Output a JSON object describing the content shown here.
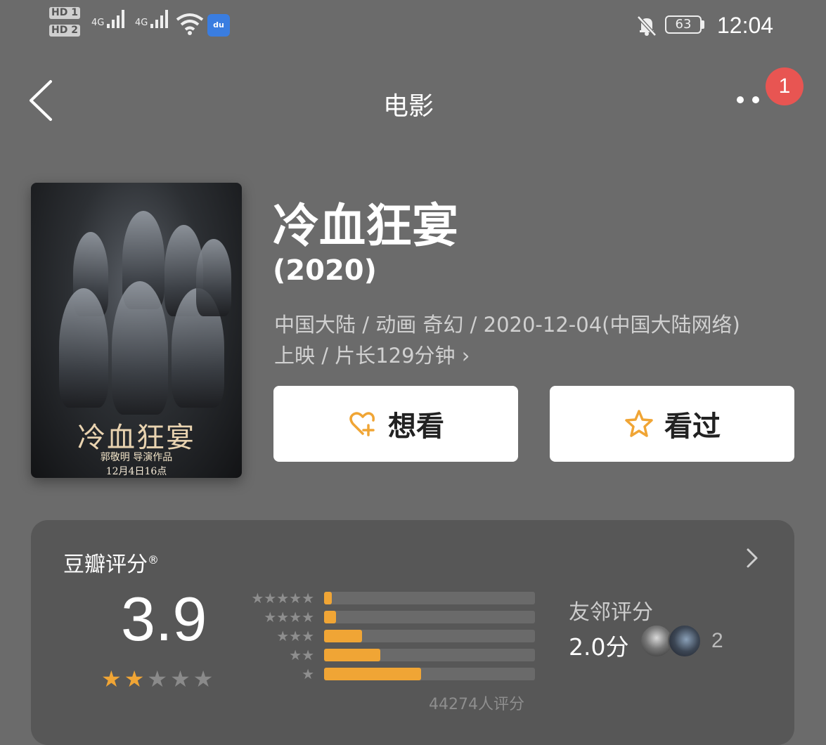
{
  "status_bar": {
    "hd1": "HD 1",
    "hd2": "HD 2",
    "net1": "4G",
    "net2": "4G",
    "baidu": "du",
    "battery": "63",
    "time": "12:04"
  },
  "nav": {
    "back_icon": "chevron-left-icon",
    "title": "电影",
    "more_icon": "more-dots-icon",
    "badge": "1"
  },
  "poster": {
    "title": "冷血狂宴",
    "subtitle": "郭敬明 导演作品",
    "date": "12月4日16点"
  },
  "movie": {
    "title": "冷血狂宴",
    "year": "(2020)",
    "meta_line1": "中国大陆 / 动画 奇幻 / 2020-12-04(中国大陆网络)",
    "meta_line2": "上映 / 片长129分钟 ›"
  },
  "actions": {
    "want_label": "想看",
    "want_icon": "heart-plus-icon",
    "seen_label": "看过",
    "seen_icon": "star-outline-icon",
    "accent": "#f0a535"
  },
  "rating": {
    "title": "豆瓣评分",
    "mark": "®",
    "score": "3.9",
    "stars_on": 2,
    "stars_total": 5,
    "distribution": [
      {
        "stars": "★★★★★",
        "fraction": 0.035
      },
      {
        "stars": "★★★★",
        "fraction": 0.055
      },
      {
        "stars": "★★★",
        "fraction": 0.18
      },
      {
        "stars": "★★",
        "fraction": 0.265
      },
      {
        "stars": "★",
        "fraction": 0.46
      }
    ],
    "count": "44274人评分",
    "friend_title": "友邻评分",
    "friend_score": "2.0分",
    "friend_count": "2",
    "chevron_icon": "chevron-right-icon"
  }
}
